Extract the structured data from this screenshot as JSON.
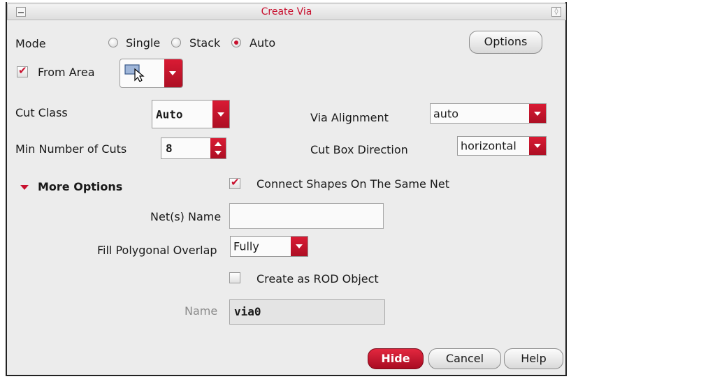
{
  "window": {
    "title": "Create Via"
  },
  "mode": {
    "label": "Mode",
    "options": [
      "Single",
      "Stack",
      "Auto"
    ],
    "selected": "Auto"
  },
  "options_button": "Options",
  "from_area": {
    "label": "From Area",
    "checked": true
  },
  "cut_class": {
    "label": "Cut Class",
    "value": "Auto"
  },
  "via_alignment": {
    "label": "Via Alignment",
    "value": "auto"
  },
  "min_cuts": {
    "label": "Min Number of Cuts",
    "value": "8"
  },
  "cut_box_direction": {
    "label": "Cut Box Direction",
    "value": "horizontal"
  },
  "more_options": {
    "label": "More Options",
    "expanded": true
  },
  "connect_shapes": {
    "label": "Connect Shapes On The Same Net",
    "checked": true
  },
  "nets_name": {
    "label": "Net(s) Name",
    "value": ""
  },
  "fill_polygonal": {
    "label": "Fill Polygonal Overlap",
    "value": "Fully"
  },
  "create_rod": {
    "label": "Create as ROD Object",
    "checked": false
  },
  "name_field": {
    "label": "Name",
    "value": "via0"
  },
  "buttons": {
    "hide": "Hide",
    "cancel": "Cancel",
    "help": "Help"
  },
  "colors": {
    "accent": "#c8102e",
    "dialog_bg": "#ececec"
  }
}
